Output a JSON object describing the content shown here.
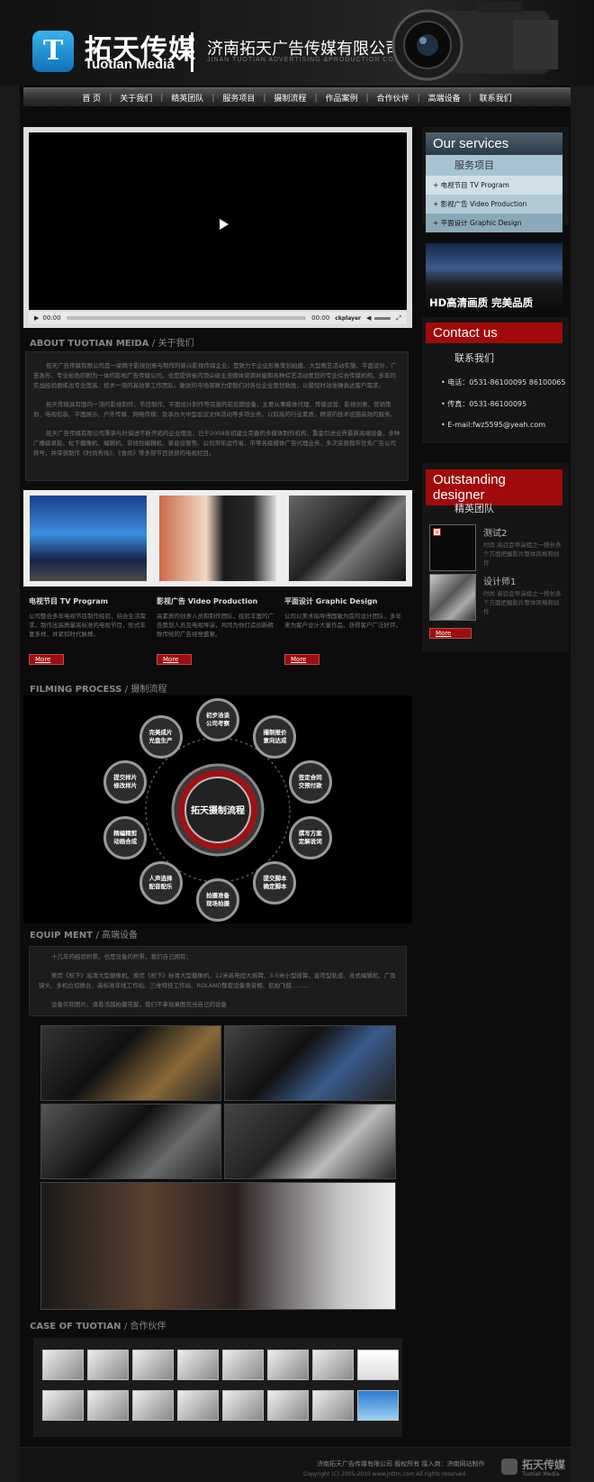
{
  "header": {
    "logo_glyph": "T",
    "logo_cn": "拓天传媒",
    "logo_en": "Tuotian Media",
    "company_cn": "济南拓天广告传媒有限公司",
    "company_en": "JINAN TUOTIAN ADVERTISING &PRODUCTION CO.,LTD"
  },
  "nav": [
    "首 页",
    "关于我们",
    "精英团队",
    "服务项目",
    "摄制流程",
    "作品案例",
    "合作伙伴",
    "高端设备",
    "联系我们"
  ],
  "video": {
    "time_current": "00:00",
    "time_total": "00:00",
    "brand": "ckplayer"
  },
  "about": {
    "title_en": "ABOUT TUOTIAN MEIDA",
    "title_cn": "/ 关于我们",
    "paragraphs": [
      "拓天广告传媒有限公司是一家精于影视创意与制作的新兴影视传媒企业。是致力于企业形象策划拍摄、大型晚艺活动实施、平面设计、广告发布、专业彩色印刷为一体的影视广告传媒公司。也是提供省内顶尖级主流媒体资源并能和各种综艺活动策划的专业综合传媒机构。多年的实战经验磨练出专业度高、技术一流的高效率工作团队。敏锐的市场洞察力使我们对各位企业策划致胜，以最短时效准确表达客户需求。",
      "拓天传媒具有国内一流的影视制作、节目制作、平面设计制作等完善的前后期设备，主要从事媒体代理、传媒运营、影视创意、营销策划、电视包装、平面展示、户外传媒、网络传媒、及承办大中型会议文体活动等多项业务。以较高的行业素质，精湛的技术设施高效的服务。",
      "拓天广告传媒有限公司秉承与时俱进不断开拓的企业理念，已于2009年初建立完备的多媒体制作机构，重金引进业界最新高端设备，多种广播级录影、松下摄像机、编辑机、非线性编辑机、录音设施等。公司常年运作省、市等各级媒体广告代理业务，多次荣获我市优秀广告公司称号，并荣获制作《时尚秀场》、《食尚》等多部节目获获的电视栏目。"
    ]
  },
  "services": [
    {
      "title": "电视节目 TV Program",
      "desc": "公司整合多年电视节目制作经验，结合生活需求，制作出高质量高标准的电视节目，形式丰富多样，并紧扣时代脉搏。",
      "more": "More"
    },
    {
      "title": "影视广告 Video Production",
      "desc": "高素质的创意人员和制作团队，经验丰富的广告策划人员及电视导演，共同为你打造创新精致传统的广告视觉盛宴。",
      "more": "More"
    },
    {
      "title": "平面设计 Graphic Design",
      "desc": "公司以美术指导傅国敏为首的设计团队，多年来为客户设计大量作品，获得客户广泛好评。",
      "more": "More"
    }
  ],
  "process": {
    "title_en": "FILMING PROCESS",
    "title_cn": "/ 摄制流程",
    "center": "拓天摄制流程",
    "steps": [
      "初步洽谈\n公司考察",
      "撮制报价\n意向达成",
      "签定合同\n交预付款",
      "撰写方案\n定解说词",
      "提交脚本\n确定脚本",
      "拍摄准备\n现场拍摄",
      "人声选择\n配音配乐",
      "精编精剪\n动画合成",
      "提交样片\n修改样片",
      "完美成片\n光盘生产"
    ]
  },
  "equipment": {
    "title_en": "EQUIP MENT",
    "title_cn": "/ 高端设备",
    "lines": [
      "十几年的经验积累，也是设备的积累，我们自己拥有：",
      "索尼《松下》高清大型摄像机、索尼《松下》标清大型摄像机、12米高电控大摇臂、3-5米小型摇臂、直弯型轨道、各式编辑机、广角镜头、多机位切换台、高标准非线工作站、三维特技工作站、ROLAND整套设备录音棚、航拍飞艇………",
      "设备实际图片，请看活越拍摄花絮，我们不拿效果图充当自己的设备"
    ]
  },
  "cases": {
    "title_en": "CASE OF TUOTIAN",
    "title_cn": "/ 合作伙伴"
  },
  "sidebar": {
    "services_head": "Our services",
    "services_sub": "服务项目",
    "service_items": [
      "+ 电视节目 TV Program",
      "+ 影视广告 Video Production",
      "+ 平面设计 Graphic Design"
    ],
    "banner_text": "HD高清画质 完美品质",
    "contact_head": "Contact us",
    "contact_sub": "联系我们",
    "phone": "• 电话：0531-86100095 86100065",
    "fax": "• 传真：0531-86100095",
    "email": "• E-mail:fwz5595@yeah.com",
    "designer_head": "Outstanding designer",
    "designer_sub": "精英团队",
    "designers": [
      {
        "name": "测试2",
        "desc": "时尚 高远会导演组之一按长各个方面把握影片整体风格和创作"
      },
      {
        "name": "设计师1",
        "desc": "时尚 高远会导演组之一按长各个方面把握影片整体风格和创作"
      }
    ],
    "designer_more": "More"
  },
  "footer": {
    "line1": "济南拓天广告传媒有限公司 版权所有 接入商：济南网站制作",
    "line2": "Copyright (C) 2005-2010 www.jnttm.com All rights reserved",
    "logo_cn": "拓天传媒",
    "logo_en": "Tuotian Media"
  }
}
